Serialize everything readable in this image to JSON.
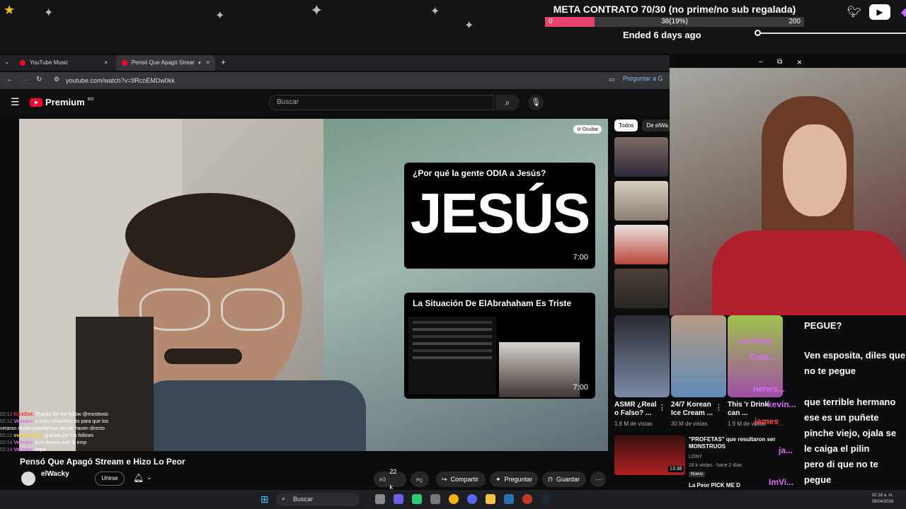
{
  "overlay": {
    "meta_title": "META CONTRATO 70/30 (no prime/no sub regalada)",
    "progress_start": "0",
    "progress_value": "38(19%)",
    "progress_end": "200",
    "progress_fraction": 0.19,
    "ended": "Ended 6 days ago"
  },
  "tabs": [
    {
      "label": "YouTube Music"
    },
    {
      "label": "Pensó Que Apagó Stream e"
    }
  ],
  "address": {
    "url": "youtube.com/watch?v=9RcoEMDw0kk",
    "ask": "Preguntar a G"
  },
  "youtube": {
    "logo": "Premium",
    "logo_sup": "MX",
    "search_placeholder": "Buscar",
    "hide_label": "Ocultar"
  },
  "cards": [
    {
      "title": "¿Por qué la gente ODIA a Jesús?",
      "big": "JESÚS",
      "duration": "7:00"
    },
    {
      "title": "La Situación De ElAbrahaham Es Triste",
      "duration": "7:00"
    }
  ],
  "video": {
    "title": "Pensó Que Apagó Stream e Hizo Lo Peor",
    "channel": "elWacky",
    "join": "Unirse",
    "likes": "22 k",
    "share": "Compartir",
    "ask": "Preguntar",
    "save": "Guardar"
  },
  "chips": [
    "Todos",
    "De elWa"
  ],
  "shorts": [
    {
      "title": "ASMR ¿Real o Falso? ...",
      "views": "1.8 M de vistas"
    },
    {
      "title": "24/7 Korean Ice Cream ...",
      "views": "30 M de vistas"
    },
    {
      "title": "This 'r Drink can ...",
      "views": "1.9 M de vistas"
    }
  ],
  "recs": [
    {
      "title": "\"PROFETAS\" que resultaron ser MONSTRUOS",
      "channel": "LONY",
      "meta": "16 k vistas · hace 2 días",
      "badge": "Nuevo",
      "duration": "13:38"
    },
    {
      "title": "La Peor PICK ME D"
    }
  ],
  "chat_right": [
    "PEGUE?",
    "Ven esposita, diles que no te pegue",
    "que terrible hermano ese es un puñete",
    "pinche viejo, ojala se le caiga el pilin",
    "pero di que no te pegue"
  ],
  "chat_right_overlay": [
    "jusehog",
    "Guat...",
    "kevin...",
    "nenes...",
    "james_",
    "ja...",
    "ImVi..."
  ],
  "chat_left": [
    {
      "time": "02:12",
      "name": "KickBot:",
      "msg": "Thanks for the follow @mosttoxic"
    },
    {
      "time": "02:12",
      "name": "Vecnarr:",
      "msg": "a esos streamers es para que los vetaran de las plataformas donde hacen directo"
    },
    {
      "time": "02:12",
      "name": "evaan12345:",
      "msg": "gracias por los follows"
    },
    {
      "time": "02:14",
      "name": "Vecnarr:",
      "msg": "a no bueno solo la emp"
    },
    {
      "time": "02:14",
      "name": "Vecnarr:",
      "msg": "sepa"
    }
  ],
  "taskbar": {
    "search": "Buscar",
    "time": "02:18 a. m.",
    "date": "06/04/2026"
  }
}
